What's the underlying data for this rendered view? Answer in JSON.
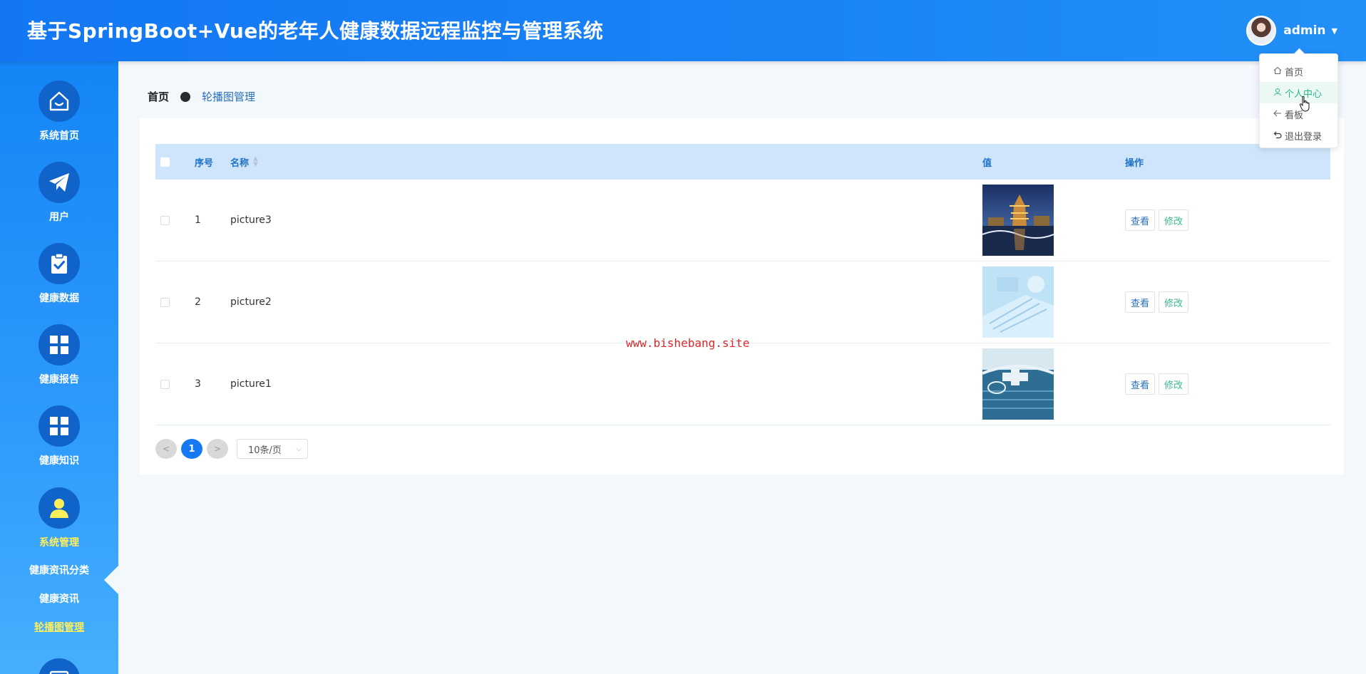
{
  "header": {
    "title": "基于SpringBoot+Vue的老年人健康数据远程监控与管理系统",
    "username": "admin"
  },
  "user_menu": {
    "items": [
      {
        "label": "首页",
        "icon": "home-icon"
      },
      {
        "label": "个人中心",
        "icon": "user-icon"
      },
      {
        "label": "看板",
        "icon": "back-arrow-icon"
      },
      {
        "label": "退出登录",
        "icon": "logout-icon"
      }
    ]
  },
  "sidebar": {
    "items": [
      {
        "label": "系统首页",
        "icon": "home-face-icon"
      },
      {
        "label": "用户",
        "icon": "paper-plane-icon"
      },
      {
        "label": "健康数据",
        "icon": "clipboard-check-icon"
      },
      {
        "label": "健康报告",
        "icon": "grid-icon"
      },
      {
        "label": "健康知识",
        "icon": "grid-icon"
      },
      {
        "label": "系统管理",
        "icon": "person-icon"
      }
    ],
    "sub_items": [
      "健康资讯分类",
      "健康资讯",
      "轮播图管理"
    ]
  },
  "breadcrumb": {
    "home": "首页",
    "current": "轮播图管理"
  },
  "table": {
    "columns": {
      "index": "序号",
      "name": "名称",
      "value": "值",
      "operation": "操作"
    },
    "rows": [
      {
        "index": "1",
        "name": "picture3"
      },
      {
        "index": "2",
        "name": "picture2"
      },
      {
        "index": "3",
        "name": "picture1"
      }
    ],
    "view_label": "查看",
    "edit_label": "修改"
  },
  "pagination": {
    "prev": "<",
    "current_page": "1",
    "next": ">",
    "page_size": "10条/页"
  },
  "watermark": "www.bishebang.site",
  "colors": {
    "header": "#1377f3",
    "sidebar": "#1585f7",
    "nav_circle": "#0f63c9",
    "active_nav": "#ffef5a",
    "table_header": "#cfe5fb",
    "edit_green": "#3bbb8c"
  }
}
